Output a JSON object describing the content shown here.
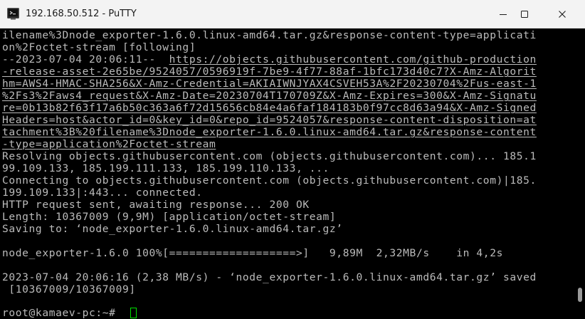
{
  "window": {
    "title": "192.168.50.512 - PuTTY",
    "icon": "putty-terminal-icon",
    "controls": [
      "minimize-icon",
      "maximize-icon",
      "close-icon"
    ]
  },
  "terminal": {
    "lines": [
      "ilename%3Dnode_exporter-1.6.0.linux-amd64.tar.gz&response-content-type=applicati",
      "on%2Foctet-stream [following]",
      "--2023-07-04 20:06:11--  ",
      "-release-asset-2e65be/9524057/0596919f-7be9-4f77-88af-1bfc173d40c7?X-Amz-Algorit",
      "hm=AWS4-HMAC-SHA256&X-Amz-Credential=AKIAIWNJYAX4CSVEH53A%2F20230704%2Fus-east-1",
      "%2Fs3%2Faws4_request&X-Amz-Date=20230704T170709Z&X-Amz-Expires=300&X-Amz-Signatu",
      "re=0b13b82f63f17a6b50c363a6f72d15656cb84e4a6faf184183b0f97cc8d63a94&X-Amz-Signed",
      "Headers=host&actor_id=0&key_id=0&repo_id=9524057&response-content-disposition=at",
      "tachment%3B%20filename%3Dnode_exporter-1.6.0.linux-amd64.tar.gz&response-content",
      "-type=application%2Foctet-stream",
      "Resolving objects.githubusercontent.com (objects.githubusercontent.com)... 185.1",
      "99.109.133, 185.199.111.133, 185.199.110.133, ...",
      "Connecting to objects.githubusercontent.com (objects.githubusercontent.com)|185.",
      "199.109.133|:443... connected.",
      "HTTP request sent, awaiting response... 200 OK",
      "Length: 10367009 (9,9M) [application/octet-stream]",
      "Saving to: ‘node_exporter-1.6.0.linux-amd64.tar.gz’",
      "",
      "node_exporter-1.6.0 100%[===================>]   9,89M  2,32MB/s    in 4,2s",
      "",
      "2023-07-04 20:06:16 (2,38 MB/s) - ‘node_exporter-1.6.0.linux-amd64.tar.gz’ saved",
      " [10367009/10367009]",
      "",
      "root@kamaev-pc:~# "
    ],
    "link_inline": "https://objects.githubusercontent.com/github-production",
    "cursor_color": "#00e000",
    "text_color": "#bbbbbb",
    "background_color": "#000000"
  }
}
